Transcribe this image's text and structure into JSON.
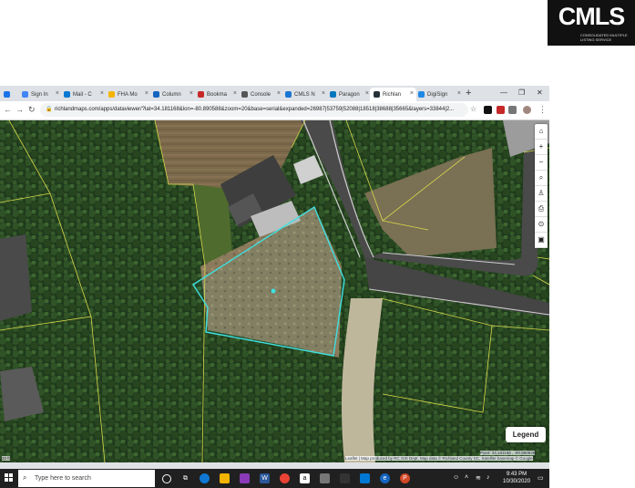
{
  "logo": {
    "main": "CMLS",
    "sub": "CONSOLIDATED MULTIPLE LISTING SERVICE"
  },
  "browser": {
    "tabs": [
      {
        "label": "",
        "color": "#1a73e8"
      },
      {
        "label": "Sign In",
        "color": "#4285f4"
      },
      {
        "label": "Mail - C",
        "color": "#0078d4"
      },
      {
        "label": "FHA Mo",
        "color": "#f4b400"
      },
      {
        "label": "Column",
        "color": "#1565c0"
      },
      {
        "label": "Bookma",
        "color": "#c62828"
      },
      {
        "label": "Console",
        "color": "#555555"
      },
      {
        "label": "CMLS N",
        "color": "#1976d2"
      },
      {
        "label": "Paragon",
        "color": "#0277bd"
      },
      {
        "label": "Richlan",
        "color": "#263238"
      },
      {
        "label": "DigiSign",
        "color": "#1e88e5"
      }
    ],
    "url": "richlandmaps.com/apps/dataviewer/?lat=34.181168&lon=-80.890588&zoom=20&base=serial&expanded=26987|53759|52088|18518|38688|35665&layers=33844|2..."
  },
  "map": {
    "legend_label": "Legend",
    "coords": "Point: 34.181168 , -80.890648",
    "attribution": "Leaflet | Map produced by RC GIS Dept, Map data © Richland County SC, Satellite basemap © Google",
    "scale": "20 ft"
  },
  "taskbar": {
    "search_placeholder": "Type here to search",
    "time": "9:43 PM",
    "date": "10/30/2020"
  }
}
